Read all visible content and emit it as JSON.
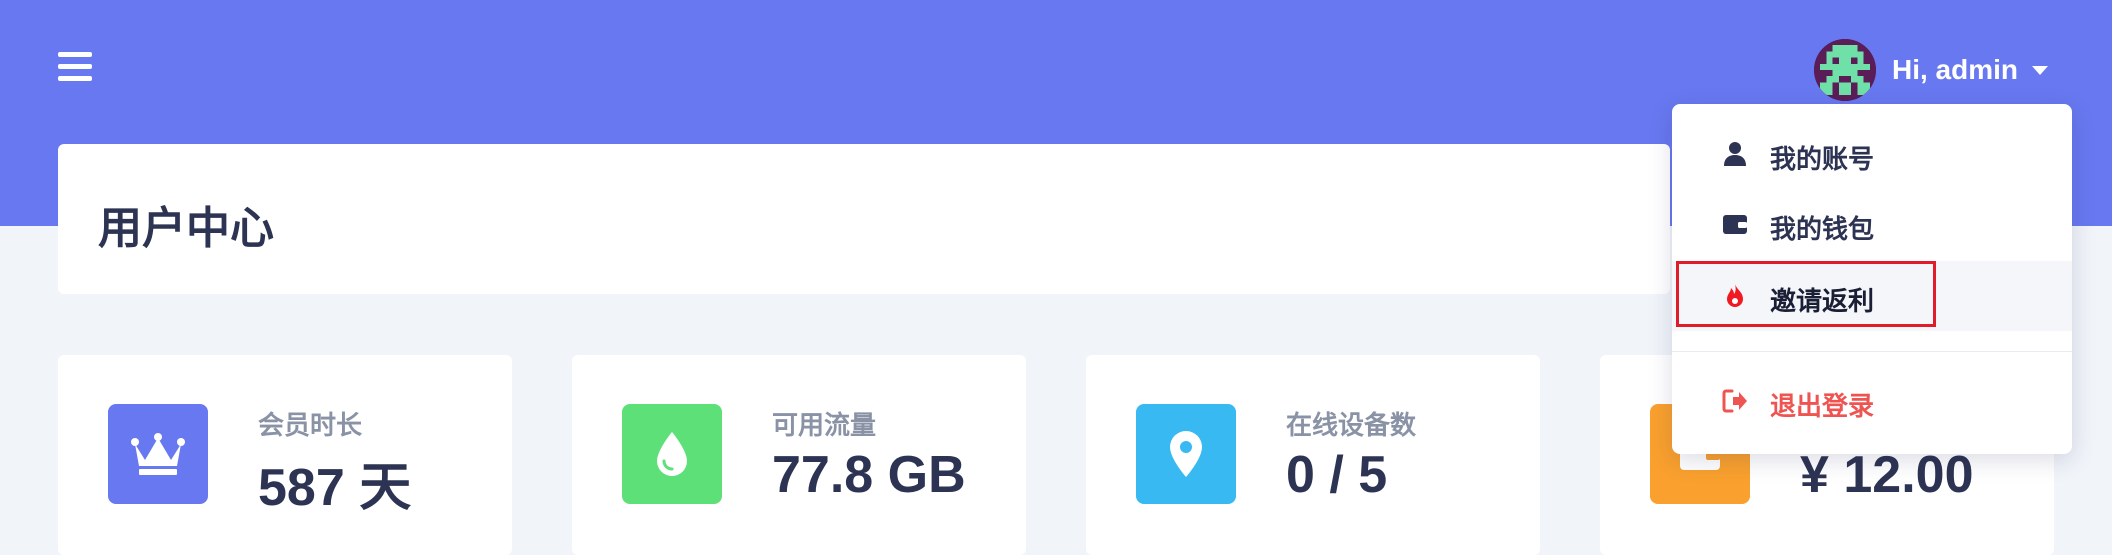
{
  "header": {
    "greeting": "Hi, admin",
    "colors": {
      "background": "#6878f0",
      "text": "#ffffff"
    }
  },
  "page": {
    "title": "用户中心"
  },
  "stats": [
    {
      "label": "会员时长",
      "value": "587 天",
      "icon": "crown-icon",
      "color": "#6878f0"
    },
    {
      "label": "可用流量",
      "value": "77.8 GB",
      "icon": "droplet-icon",
      "color": "#5ee079"
    },
    {
      "label": "在线设备数",
      "value": "0 / 5",
      "icon": "map-marker-icon",
      "color": "#38b9f2"
    },
    {
      "label": "",
      "value": "¥ 12.00",
      "icon": "wallet-icon",
      "color": "#f9a02e"
    }
  ],
  "dropdown": {
    "items": [
      {
        "label": "我的账号",
        "icon": "user-icon"
      },
      {
        "label": "我的钱包",
        "icon": "wallet-icon"
      },
      {
        "label": "邀请返利",
        "icon": "fire-icon",
        "active": true
      },
      {
        "label": "退出登录",
        "icon": "sign-out-icon",
        "color": "#ee5552"
      }
    ]
  }
}
